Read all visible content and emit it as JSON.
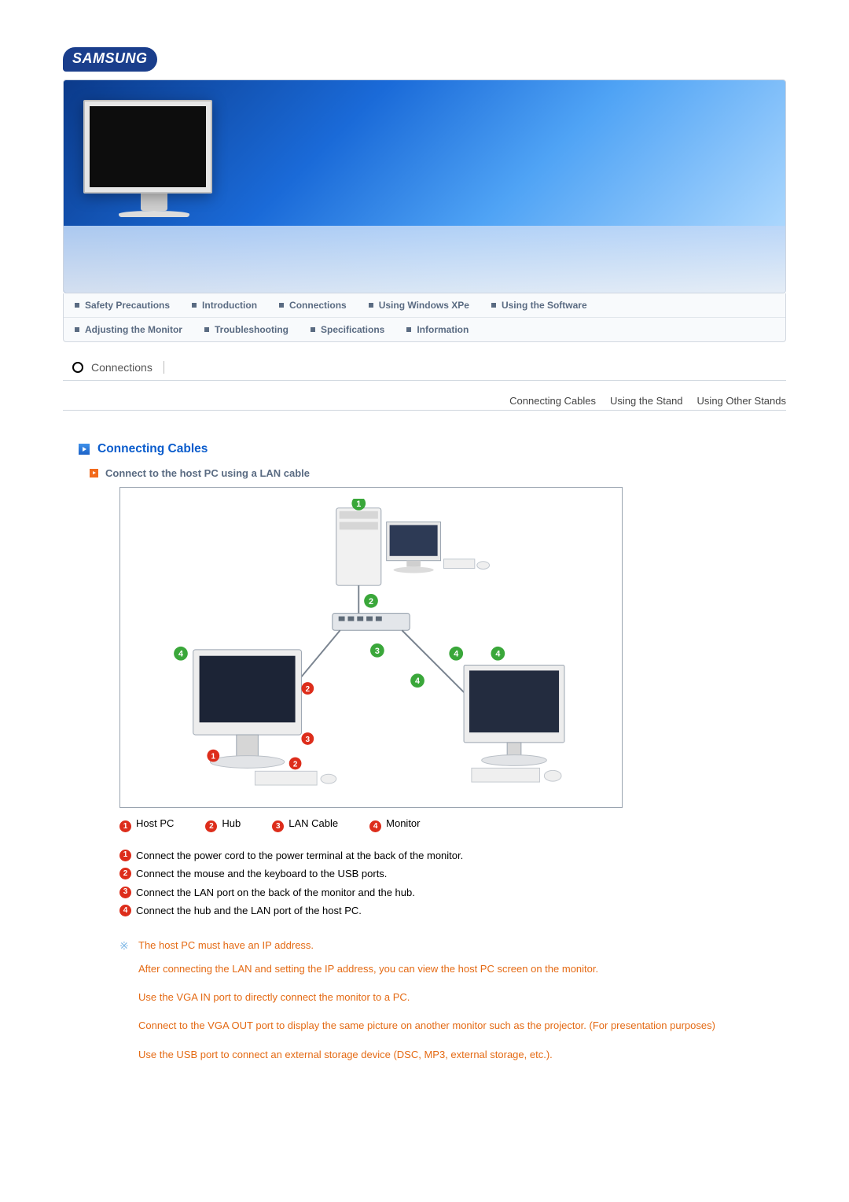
{
  "brand": "SAMSUNG",
  "nav": {
    "row1": [
      "Safety Precautions",
      "Introduction",
      "Connections",
      "Using Windows XPe",
      "Using the Software"
    ],
    "row2": [
      "Adjusting the Monitor",
      "Troubleshooting",
      "Specifications",
      "Information"
    ]
  },
  "breadcrumb": "Connections",
  "subnav": [
    "Connecting Cables",
    "Using the Stand",
    "Using Other Stands"
  ],
  "section_title": "Connecting Cables",
  "sub_heading": "Connect to the host PC using a LAN cable",
  "legend": {
    "l1": "Host PC",
    "l2": "Hub",
    "l3": "LAN Cable",
    "l4": "Monitor"
  },
  "steps": [
    "Connect the power cord to the power terminal at the back of the monitor.",
    "Connect the mouse and the keyboard to the USB ports.",
    "Connect the LAN port on the back of the monitor and the hub.",
    "Connect the hub and the LAN port of the host PC."
  ],
  "notes": [
    "The host PC must have an IP address.",
    "After connecting the LAN and setting the IP address, you can view the host PC screen on the monitor.",
    "Use the VGA IN port to directly connect the monitor to a PC.",
    "Connect to the VGA OUT port to display the same picture on another monitor such as the projector. (For presentation purposes)",
    "Use the USB port to connect an external storage device (DSC, MP3, external storage, etc.)."
  ]
}
